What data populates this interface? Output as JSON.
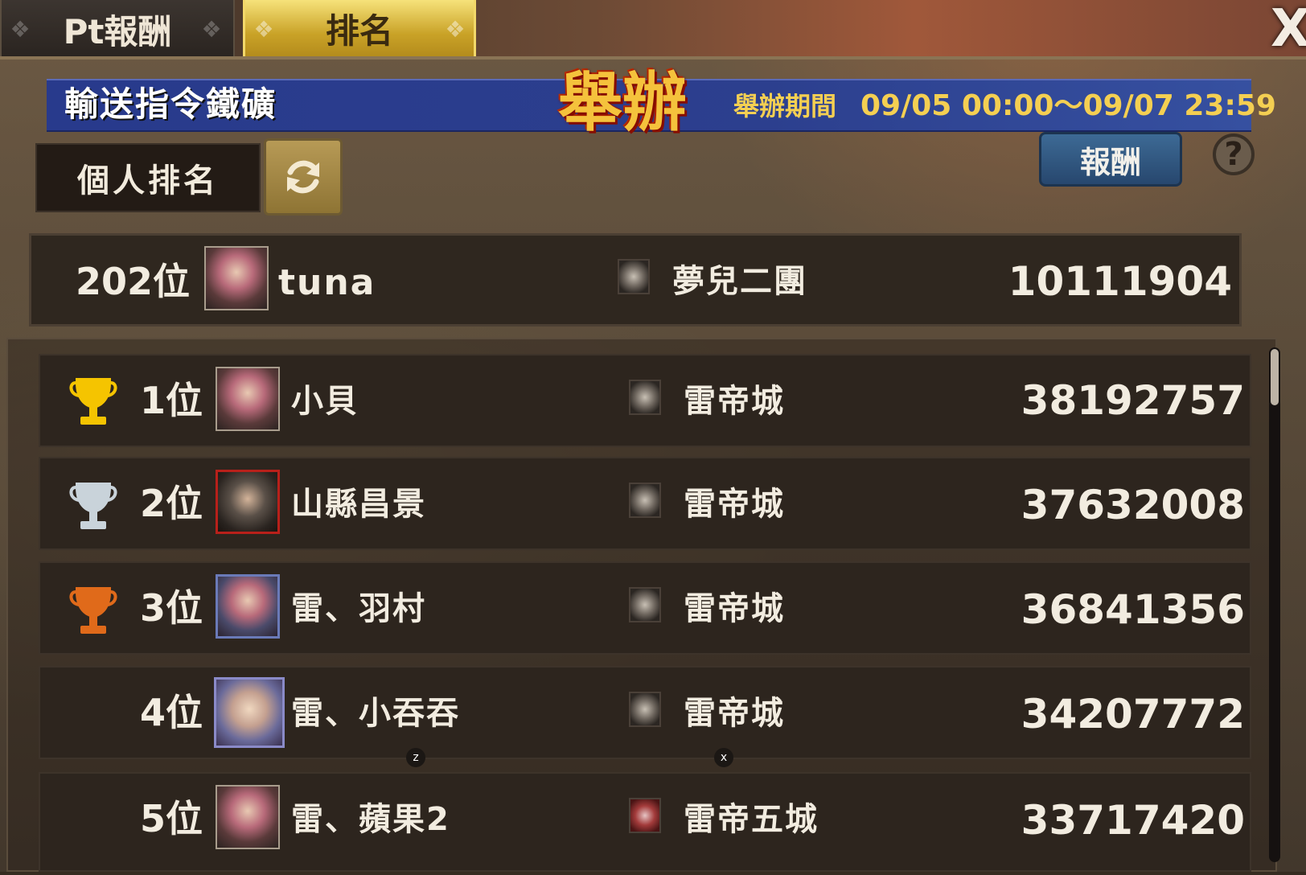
{
  "tabs": {
    "pt_reward": "Pt報酬",
    "ranking": "排名"
  },
  "close_label": "X",
  "event": {
    "name": "輸送指令鐵礦",
    "held": "舉辦",
    "period_label": "舉辦期間",
    "period_value": "09/05  00:00～09/07  23:59"
  },
  "controls": {
    "personal_ranking": "個人排名",
    "reward": "報酬",
    "help": "?"
  },
  "my_rank": {
    "rank": "202位",
    "name": "tuna",
    "guild": "夢兒二團",
    "score": "10111904"
  },
  "rankings": [
    {
      "rank": "1位",
      "name": "小貝",
      "guild": "雷帝城",
      "score": "38192757",
      "trophy": "gold"
    },
    {
      "rank": "2位",
      "name": "山縣昌景",
      "guild": "雷帝城",
      "score": "37632008",
      "trophy": "silver"
    },
    {
      "rank": "3位",
      "name": "雷、羽村",
      "guild": "雷帝城",
      "score": "36841356",
      "trophy": "bronze"
    },
    {
      "rank": "4位",
      "name": "雷、小吞吞",
      "guild": "雷帝城",
      "score": "34207772",
      "trophy": ""
    },
    {
      "rank": "5位",
      "name": "雷、蘋果2",
      "guild": "雷帝五城",
      "score": "33717420",
      "trophy": ""
    }
  ],
  "key_hints": [
    "z",
    "x"
  ],
  "colors": {
    "banner": "#2c3f8e",
    "active_tab": "#c9a227",
    "gold": "#f5c400",
    "silver": "#c9d3da",
    "bronze": "#e06a1a",
    "reward_button": "#27476e"
  }
}
